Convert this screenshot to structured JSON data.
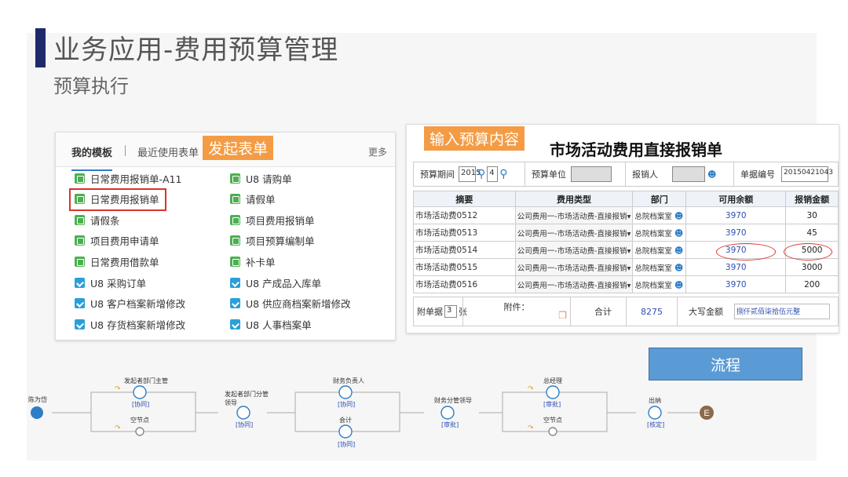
{
  "header": {
    "title": "业务应用-费用预算管理",
    "subtitle": "预算执行"
  },
  "templates": {
    "tab_active": "我的模板",
    "tab_recent": "最近使用表单",
    "more": "更多",
    "callout": "发起表单",
    "left_items": [
      {
        "label": "日常费用报销单-A11",
        "icon": "form-green-icon"
      },
      {
        "label": "日常费用报销单",
        "icon": "form-green-icon"
      },
      {
        "label": "请假条",
        "icon": "form-green-icon"
      },
      {
        "label": "项目费用申请单",
        "icon": "form-green-icon"
      },
      {
        "label": "日常费用借款单",
        "icon": "form-green-icon"
      },
      {
        "label": "U8 采购订单",
        "icon": "u8-blue-icon"
      },
      {
        "label": "U8 客户档案新增修改",
        "icon": "u8-blue-icon"
      },
      {
        "label": "U8 存货档案新增修改",
        "icon": "u8-blue-icon"
      }
    ],
    "right_items": [
      {
        "label": "U8 请购单",
        "icon": "form-green-icon"
      },
      {
        "label": "请假单",
        "icon": "form-green-icon"
      },
      {
        "label": "项目费用报销单",
        "icon": "form-green-icon"
      },
      {
        "label": "项目预算编制单",
        "icon": "form-green-icon"
      },
      {
        "label": "补卡单",
        "icon": "form-green-icon"
      },
      {
        "label": "U8 产成品入库单",
        "icon": "u8-blue-icon"
      },
      {
        "label": "U8 供应商档案新增修改",
        "icon": "u8-blue-icon"
      },
      {
        "label": "U8 人事档案单",
        "icon": "u8-blue-icon"
      }
    ]
  },
  "form": {
    "callout": "输入预算内容",
    "title": "市场活动费用直接报销单",
    "period_label": "预算期间",
    "period_year": "2015",
    "period_month": "4",
    "unit_label": "预算单位",
    "reporter_label": "报销人",
    "doc_no_label": "单据编号",
    "doc_no": "20150421043",
    "columns": [
      "摘要",
      "费用类型",
      "部门",
      "可用余额",
      "报销金额"
    ],
    "rows": [
      {
        "summary": "市场活动费0512",
        "type": "公司费用一-市场活动费-直接报销",
        "dept": "总院档案室",
        "balance": "3970",
        "amount": "30"
      },
      {
        "summary": "市场活动费0513",
        "type": "公司费用一-市场活动费-直接报销",
        "dept": "总院档案室",
        "balance": "3970",
        "amount": "45"
      },
      {
        "summary": "市场活动费0514",
        "type": "公司费用一-市场活动费-直接报销",
        "dept": "总院档案室",
        "balance": "3970",
        "amount": "5000"
      },
      {
        "summary": "市场活动费0515",
        "type": "公司费用一-市场活动费-直接报销",
        "dept": "总院档案室",
        "balance": "3970",
        "amount": "3000"
      },
      {
        "summary": "市场活动费0516",
        "type": "公司费用一-市场活动费-直接报销",
        "dept": "总院档案室",
        "balance": "3970",
        "amount": "200"
      }
    ],
    "attach_label": "附单据",
    "attach_count": "3",
    "attach_unit": "张",
    "attachment_label": "附件：",
    "total_label": "合计",
    "total": "8275",
    "capital_label": "大写金额",
    "capital": "捌仟贰佰柒拾伍元整"
  },
  "flow_button": "流程",
  "flow": {
    "start": "陈为岱",
    "n1_top": "发起者部门主管",
    "n1_top_tag": "[协同]",
    "n1_bottom": "空节点",
    "n2": "发起者部门分管领导",
    "n2_tag": "[协同]",
    "n3_top": "财务负责人",
    "n3_top_tag": "[协同]",
    "n3_bottom": "会计",
    "n3_bottom_tag": "[协同]",
    "n4": "财务分管领导",
    "n4_tag": "[审批]",
    "n5_top": "总经理",
    "n5_top_tag": "[审批]",
    "n5_bottom": "空节点",
    "n6": "出纳",
    "n6_tag": "[核定]",
    "end": "E"
  }
}
